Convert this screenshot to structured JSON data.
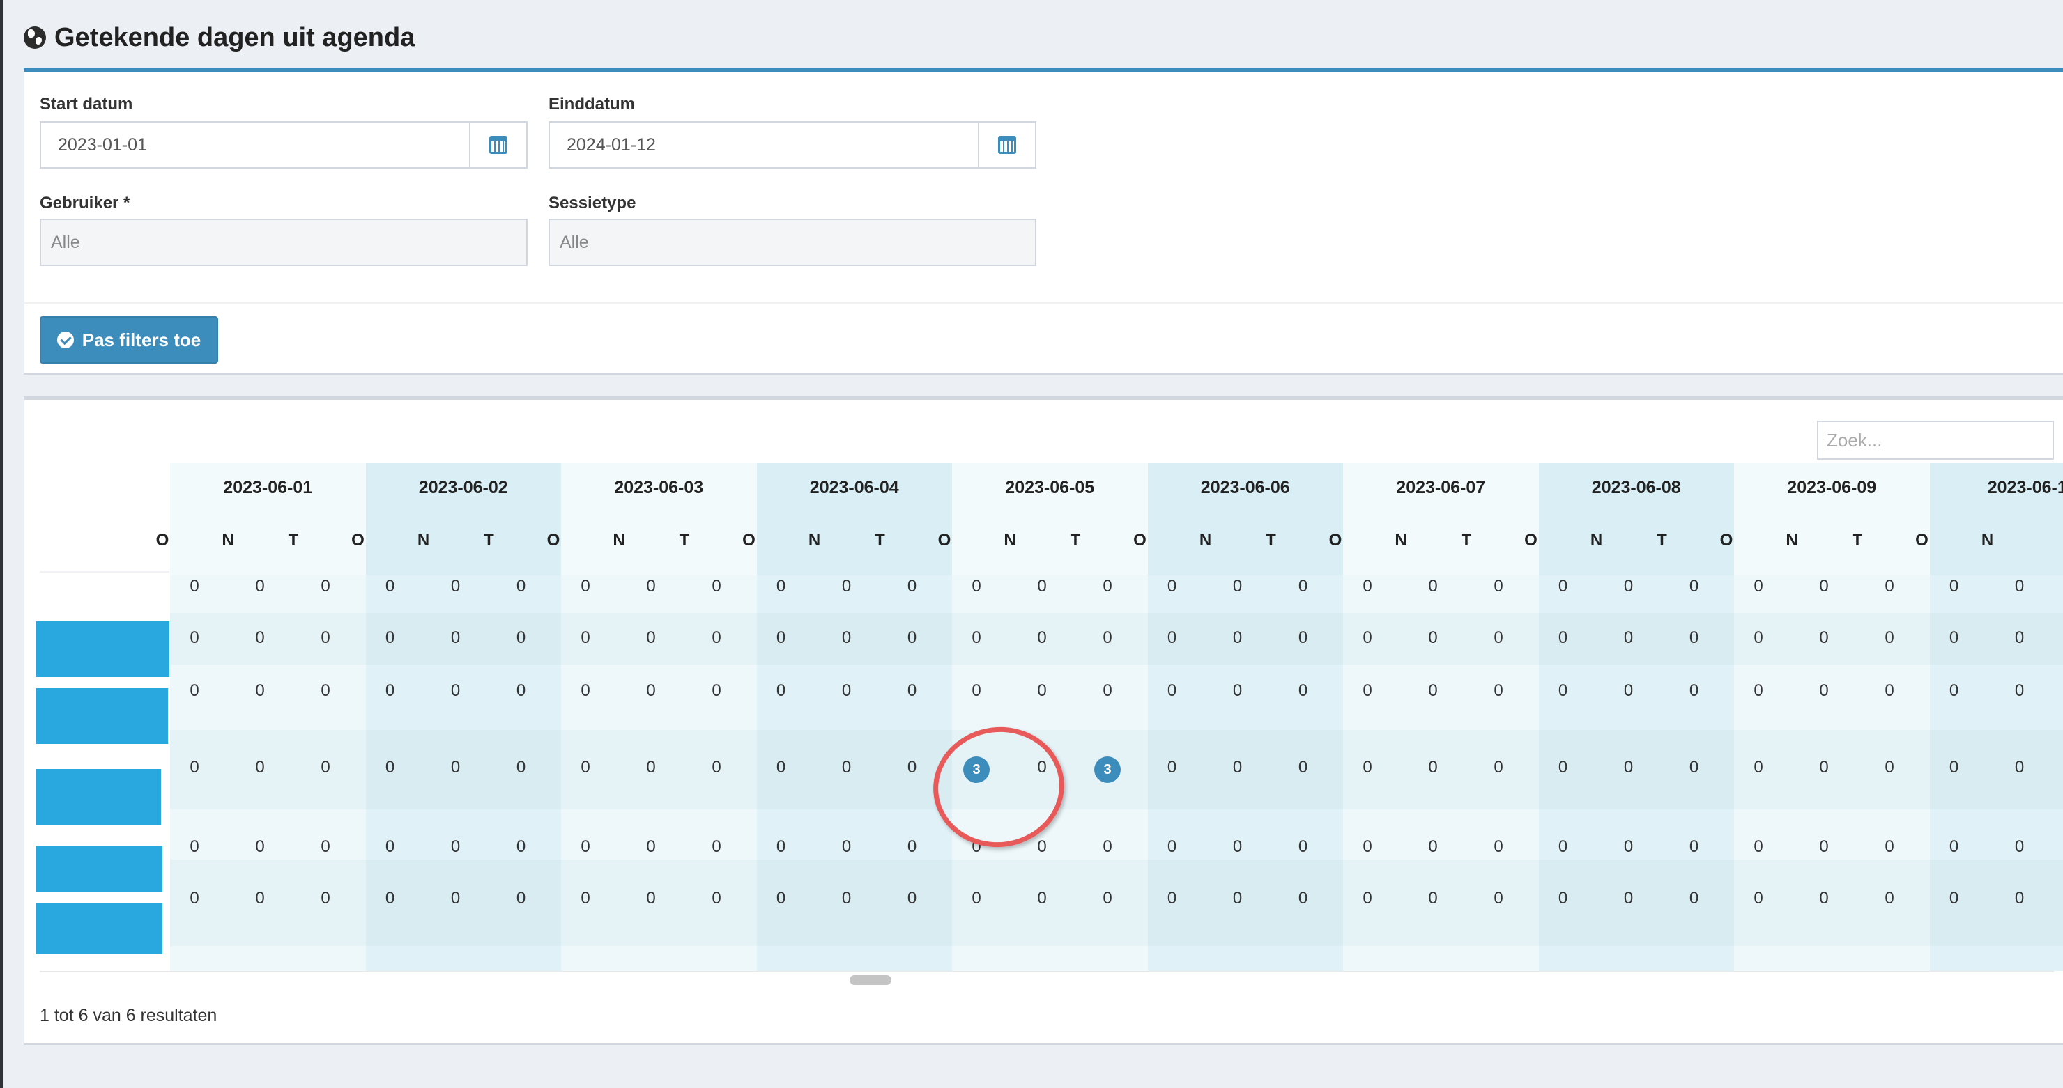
{
  "page": {
    "title": "Getekende dagen uit agenda",
    "title_icon": "globe-icon"
  },
  "filters": {
    "start": {
      "label": "Start datum",
      "value": "2023-01-01",
      "icon": "calendar-icon"
    },
    "end": {
      "label": "Einddatum",
      "value": "2024-01-12",
      "icon": "calendar-icon"
    },
    "user": {
      "label": "Gebruiker *",
      "value": "Alle"
    },
    "session_type": {
      "label": "Sessietype",
      "value": "Alle"
    },
    "apply_label": "Pas filters toe",
    "apply_icon": "check-circle-icon"
  },
  "results": {
    "search_placeholder": "Zoek...",
    "count_text": "1 tot 6 van 6 resultaten",
    "dates": [
      "2023-06-01",
      "2023-06-02",
      "2023-06-03",
      "2023-06-04",
      "2023-06-05",
      "2023-06-06",
      "2023-06-07",
      "2023-06-08",
      "2023-06-09",
      "2023-06-1"
    ],
    "day_parts": [
      "O",
      "N",
      "T"
    ],
    "rows": [
      [
        "0",
        "0",
        "0",
        "0",
        "0",
        "0",
        "0",
        "0",
        "0",
        "0",
        "0",
        "0",
        "0",
        "0",
        "0",
        "0",
        "0",
        "0",
        "0",
        "0",
        "0",
        "0",
        "0",
        "0",
        "0",
        "0",
        "0",
        "0",
        "0"
      ],
      [
        "0",
        "0",
        "0",
        "0",
        "0",
        "0",
        "0",
        "0",
        "0",
        "0",
        "0",
        "0",
        "0",
        "0",
        "0",
        "0",
        "0",
        "0",
        "0",
        "0",
        "0",
        "0",
        "0",
        "0",
        "0",
        "0",
        "0",
        "0",
        "0"
      ],
      [
        "0",
        "0",
        "0",
        "0",
        "0",
        "0",
        "0",
        "0",
        "0",
        "0",
        "0",
        "0",
        "0",
        "0",
        "0",
        "0",
        "0",
        "0",
        "0",
        "0",
        "0",
        "0",
        "0",
        "0",
        "0",
        "0",
        "0",
        "0",
        "0"
      ],
      [
        "0",
        "0",
        "0",
        "0",
        "0",
        "0",
        "0",
        "0",
        "0",
        "0",
        "0",
        "0",
        "3",
        "0",
        "3",
        "0",
        "0",
        "0",
        "0",
        "0",
        "0",
        "0",
        "0",
        "0",
        "0",
        "0",
        "0",
        "0",
        "0"
      ],
      [
        "0",
        "0",
        "0",
        "0",
        "0",
        "0",
        "0",
        "0",
        "0",
        "0",
        "0",
        "0",
        "0",
        "0",
        "0",
        "0",
        "0",
        "0",
        "0",
        "0",
        "0",
        "0",
        "0",
        "0",
        "0",
        "0",
        "0",
        "0",
        "0"
      ],
      [
        "0",
        "0",
        "0",
        "0",
        "0",
        "0",
        "0",
        "0",
        "0",
        "0",
        "0",
        "0",
        "0",
        "0",
        "0",
        "0",
        "0",
        "0",
        "0",
        "0",
        "0",
        "0",
        "0",
        "0",
        "0",
        "0",
        "0",
        "0",
        "0"
      ]
    ],
    "highlight_color": "#e85a5a",
    "accent_color": "#3c8dbc",
    "row_label_color": "#29a8e0"
  }
}
